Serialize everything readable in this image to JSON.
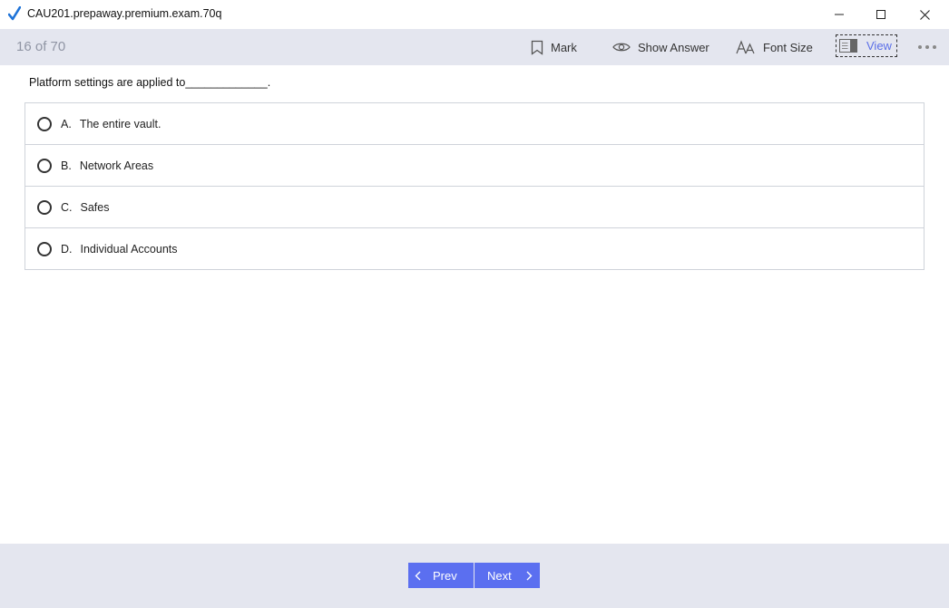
{
  "window": {
    "title": "CAU201.prepaway.premium.exam.70q",
    "icons": {
      "app": "checkmark-icon",
      "minimize": "minimize-icon",
      "maximize": "maximize-icon",
      "close": "close-icon"
    }
  },
  "toolbar": {
    "counter": "16 of 70",
    "mark_label": "Mark",
    "show_answer_label": "Show Answer",
    "font_size_label": "Font Size",
    "view_label": "View",
    "icons": {
      "mark": "bookmark-icon",
      "show_answer": "eye-icon",
      "font_size": "font-size-icon",
      "view": "view-layout-icon",
      "more": "more-icon"
    }
  },
  "question": {
    "text": "Platform settings are applied to_____________.",
    "options": [
      {
        "letter": "A.",
        "text": "The entire vault."
      },
      {
        "letter": "B.",
        "text": "Network Areas"
      },
      {
        "letter": "C.",
        "text": "Safes"
      },
      {
        "letter": "D.",
        "text": "Individual Accounts"
      }
    ]
  },
  "footer": {
    "prev_label": "Prev",
    "next_label": "Next",
    "icons": {
      "prev": "chevron-left-icon",
      "next": "chevron-right-icon"
    }
  },
  "colors": {
    "accent": "#5b6ff0",
    "toolbar_bg": "#e4e6ef",
    "counter_text": "#9095a4",
    "app_icon": "#1e73d8"
  }
}
